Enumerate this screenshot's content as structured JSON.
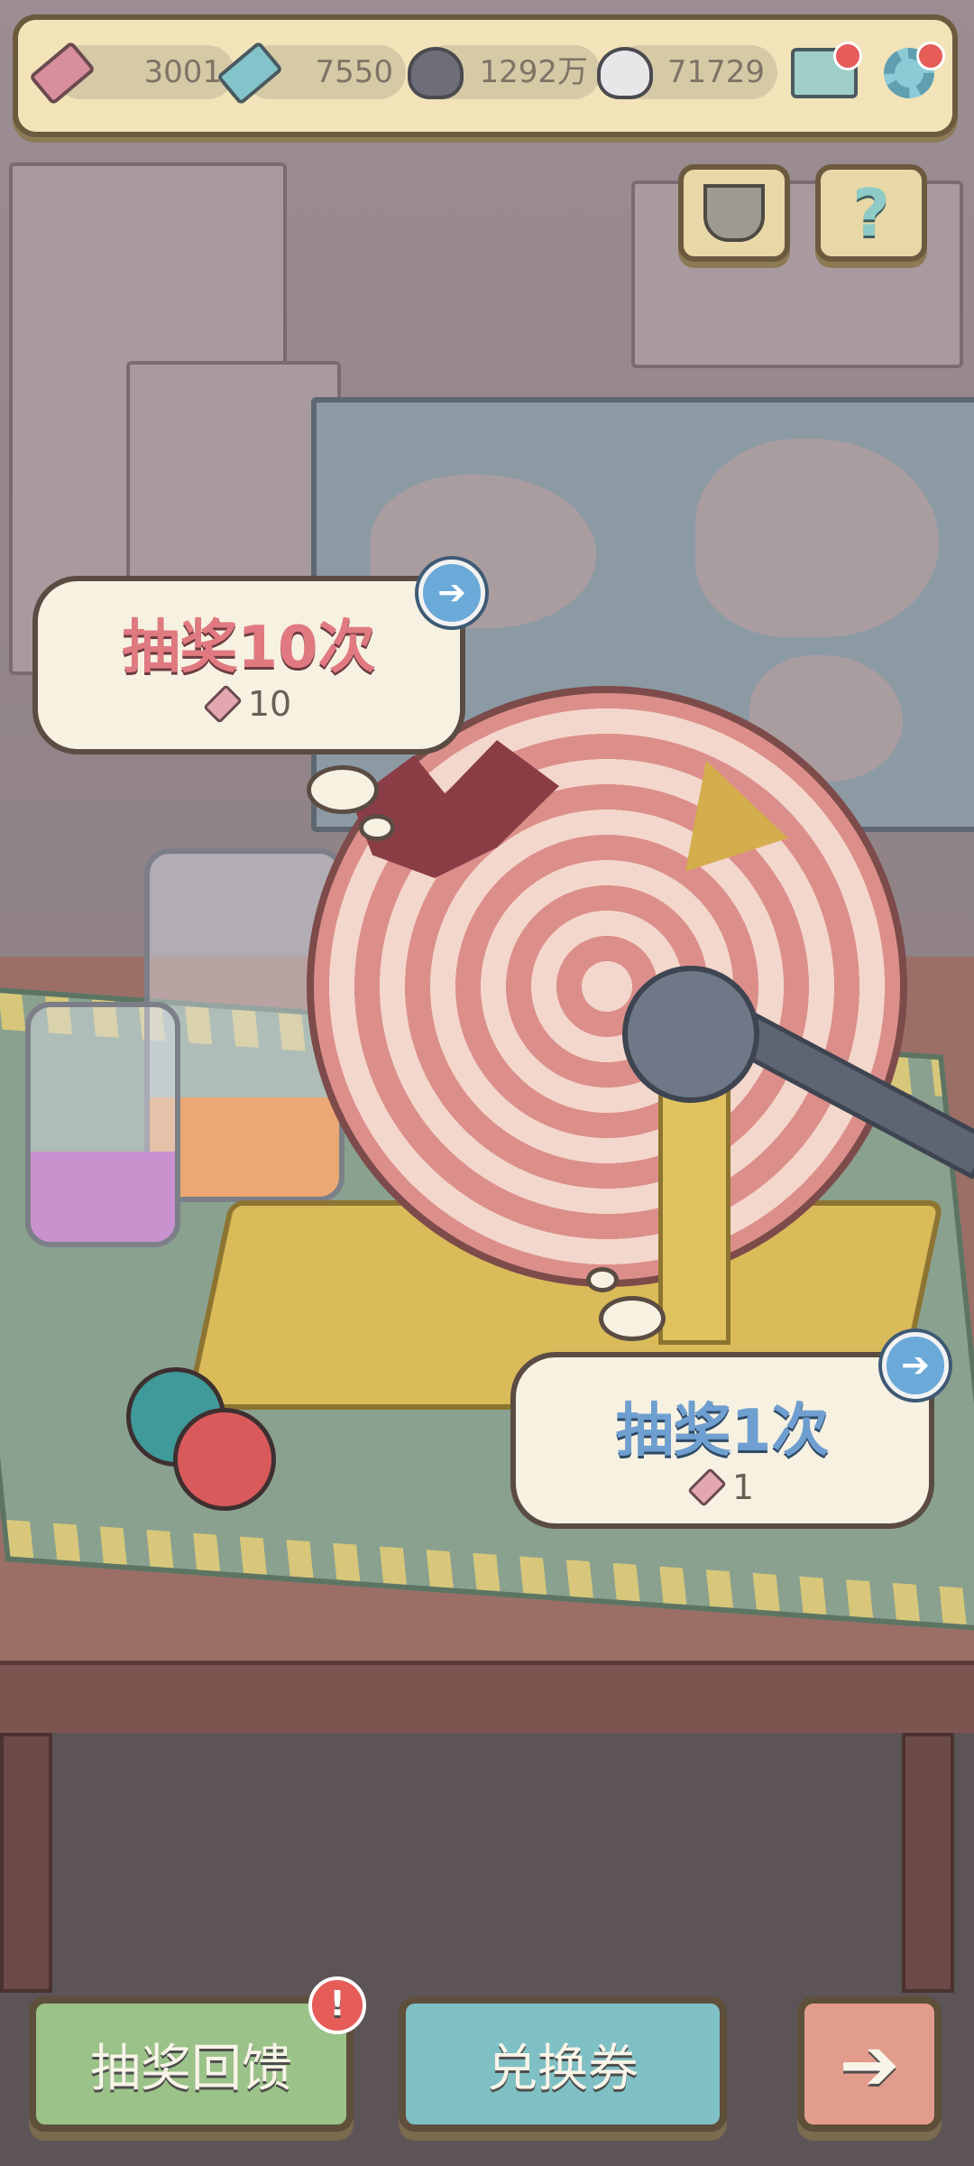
{
  "hud": {
    "lottery_tickets": "3001",
    "exchange_coupons": "7550",
    "dark_souls": "1292万",
    "light_souls": "71729"
  },
  "actions": {
    "draw_ten": {
      "label": "抽奖10次",
      "cost": "10"
    },
    "draw_one": {
      "label": "抽奖1次",
      "cost": "1"
    }
  },
  "bottom": {
    "feedback_label": "抽奖回馈",
    "feedback_badge": "!",
    "exchange_label": "兑换券"
  },
  "colors": {
    "draw_ten_text": "#e07a80",
    "draw_one_text": "#6f9fd0",
    "feedback_bg": "#9bc288",
    "exchange_bg": "#7fc0c4",
    "next_bg": "#e29c8c"
  },
  "icons": {
    "ticket": "ticket-icon",
    "coupon": "coupon-icon",
    "dark_soul": "dark-ghost-icon",
    "light_soul": "light-ghost-icon",
    "mail": "mail-icon",
    "settings": "gear-icon",
    "trophy": "trophy-icon",
    "help": "question-icon",
    "arrow": "arrow-right-icon"
  }
}
